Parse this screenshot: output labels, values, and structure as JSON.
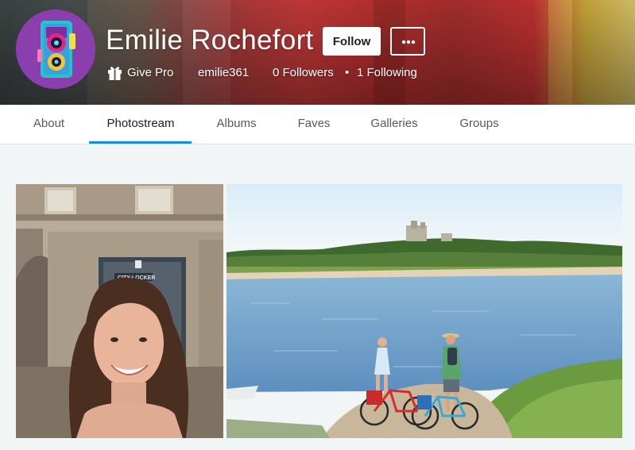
{
  "profile": {
    "name": "Emilie Rochefort",
    "username": "emilie361",
    "give_pro_label": "Give Pro",
    "followers_label": "0 Followers",
    "separator": "•",
    "following_label": "1 Following"
  },
  "actions": {
    "follow_label": "Follow"
  },
  "tabs": [
    {
      "label": "About"
    },
    {
      "label": "Photostream"
    },
    {
      "label": "Albums"
    },
    {
      "label": "Faves"
    },
    {
      "label": "Galleries"
    },
    {
      "label": "Groups"
    }
  ],
  "active_tab": "Photostream",
  "photos": [
    {
      "sign_text": "CITY-LOCKER"
    },
    {}
  ],
  "colors": {
    "accent": "#128fdc",
    "follow_button_bg": "#ffffff",
    "page_bg": "#f2f5f6"
  },
  "icons": [
    "gift-icon",
    "more-dots-icon",
    "camera-avatar-icon"
  ]
}
